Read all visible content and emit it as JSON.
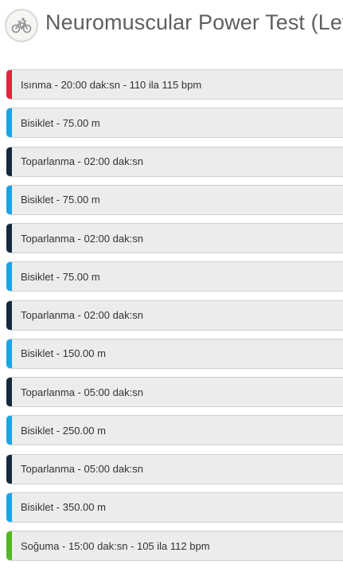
{
  "header": {
    "title": "Neuromuscular Power Test (Level",
    "icon": "bicycle-icon"
  },
  "colors": {
    "warmup": "#e8213c",
    "bike": "#1aa3e8",
    "recovery": "#15293d",
    "cooldown": "#52b720"
  },
  "steps": [
    {
      "type": "warmup",
      "label": "Isınma - 20:00 dak:sn - 110 ila 115 bpm"
    },
    {
      "type": "bike",
      "label": "Bisiklet - 75.00 m"
    },
    {
      "type": "recovery",
      "label": "Toparlanma - 02:00 dak:sn"
    },
    {
      "type": "bike",
      "label": "Bisiklet - 75.00 m"
    },
    {
      "type": "recovery",
      "label": "Toparlanma - 02:00 dak:sn"
    },
    {
      "type": "bike",
      "label": "Bisiklet - 75.00 m"
    },
    {
      "type": "recovery",
      "label": "Toparlanma - 02:00 dak:sn"
    },
    {
      "type": "bike",
      "label": "Bisiklet - 150.00 m"
    },
    {
      "type": "recovery",
      "label": "Toparlanma - 05:00 dak:sn"
    },
    {
      "type": "bike",
      "label": "Bisiklet - 250.00 m"
    },
    {
      "type": "recovery",
      "label": "Toparlanma - 05:00 dak:sn"
    },
    {
      "type": "bike",
      "label": "Bisiklet - 350.00 m"
    },
    {
      "type": "cooldown",
      "label": "Soğuma - 15:00 dak:sn - 105 ila 112 bpm"
    }
  ]
}
